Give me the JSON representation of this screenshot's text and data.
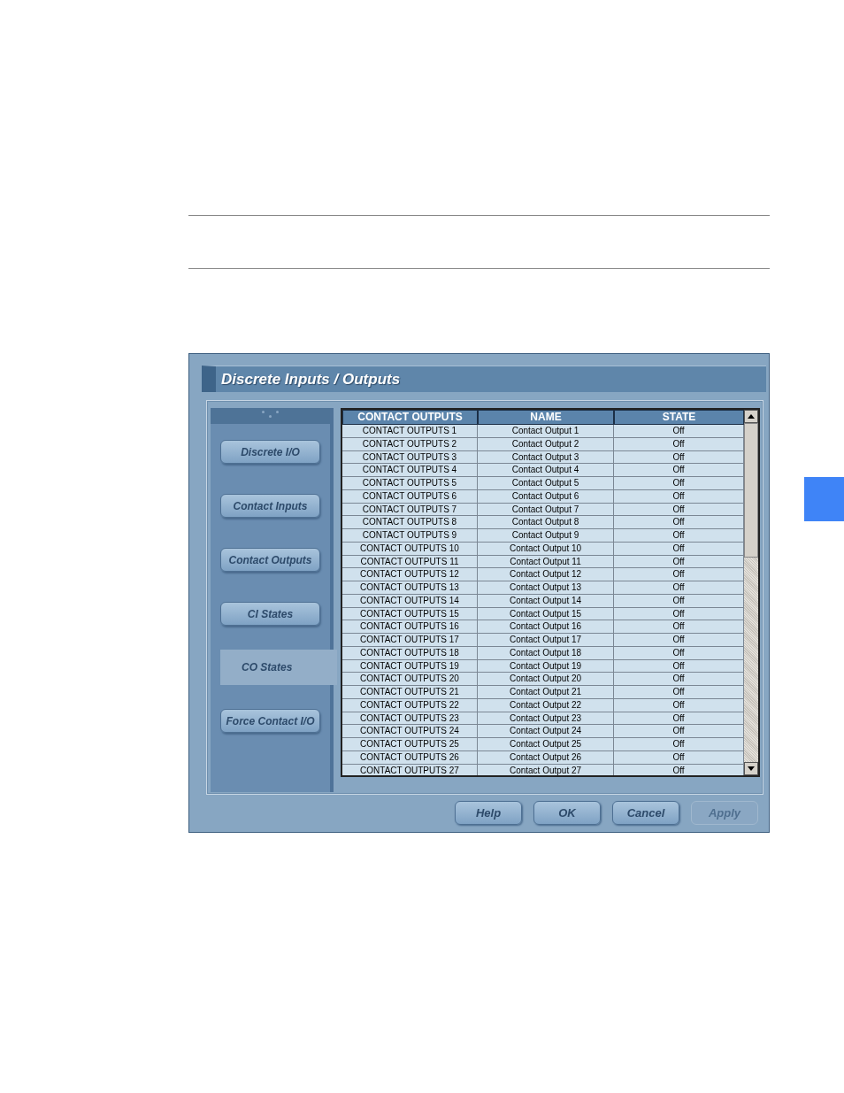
{
  "window": {
    "title": "Discrete Inputs / Outputs"
  },
  "nav": [
    {
      "label": "Discrete I/O",
      "selected": false
    },
    {
      "label": "Contact Inputs",
      "selected": false
    },
    {
      "label": "Contact Outputs",
      "selected": false
    },
    {
      "label": "CI States",
      "selected": false
    },
    {
      "label": "CO States",
      "selected": true
    },
    {
      "label": "Force Contact I/O",
      "selected": false
    }
  ],
  "table": {
    "columns": [
      "CONTACT OUTPUTS",
      "NAME",
      "STATE"
    ],
    "rows": [
      [
        "CONTACT OUTPUTS 1",
        "Contact Output 1",
        "Off"
      ],
      [
        "CONTACT OUTPUTS 2",
        "Contact Output 2",
        "Off"
      ],
      [
        "CONTACT OUTPUTS 3",
        "Contact Output 3",
        "Off"
      ],
      [
        "CONTACT OUTPUTS 4",
        "Contact Output 4",
        "Off"
      ],
      [
        "CONTACT OUTPUTS 5",
        "Contact Output 5",
        "Off"
      ],
      [
        "CONTACT OUTPUTS 6",
        "Contact Output 6",
        "Off"
      ],
      [
        "CONTACT OUTPUTS 7",
        "Contact Output 7",
        "Off"
      ],
      [
        "CONTACT OUTPUTS 8",
        "Contact Output 8",
        "Off"
      ],
      [
        "CONTACT OUTPUTS 9",
        "Contact Output 9",
        "Off"
      ],
      [
        "CONTACT OUTPUTS 10",
        "Contact Output 10",
        "Off"
      ],
      [
        "CONTACT OUTPUTS 11",
        "Contact Output 11",
        "Off"
      ],
      [
        "CONTACT OUTPUTS 12",
        "Contact Output 12",
        "Off"
      ],
      [
        "CONTACT OUTPUTS 13",
        "Contact Output 13",
        "Off"
      ],
      [
        "CONTACT OUTPUTS 14",
        "Contact Output 14",
        "Off"
      ],
      [
        "CONTACT OUTPUTS 15",
        "Contact Output 15",
        "Off"
      ],
      [
        "CONTACT OUTPUTS 16",
        "Contact Output 16",
        "Off"
      ],
      [
        "CONTACT OUTPUTS 17",
        "Contact Output 17",
        "Off"
      ],
      [
        "CONTACT OUTPUTS 18",
        "Contact Output 18",
        "Off"
      ],
      [
        "CONTACT OUTPUTS 19",
        "Contact Output 19",
        "Off"
      ],
      [
        "CONTACT OUTPUTS 20",
        "Contact Output 20",
        "Off"
      ],
      [
        "CONTACT OUTPUTS 21",
        "Contact Output 21",
        "Off"
      ],
      [
        "CONTACT OUTPUTS 22",
        "Contact Output 22",
        "Off"
      ],
      [
        "CONTACT OUTPUTS 23",
        "Contact Output 23",
        "Off"
      ],
      [
        "CONTACT OUTPUTS 24",
        "Contact Output 24",
        "Off"
      ],
      [
        "CONTACT OUTPUTS 25",
        "Contact Output 25",
        "Off"
      ],
      [
        "CONTACT OUTPUTS 26",
        "Contact Output 26",
        "Off"
      ],
      [
        "CONTACT OUTPUTS 27",
        "Contact Output 27",
        "Off"
      ]
    ]
  },
  "buttons": [
    {
      "label": "Help",
      "disabled": false
    },
    {
      "label": "OK",
      "disabled": false
    },
    {
      "label": "Cancel",
      "disabled": false
    },
    {
      "label": "Apply",
      "disabled": true
    }
  ]
}
